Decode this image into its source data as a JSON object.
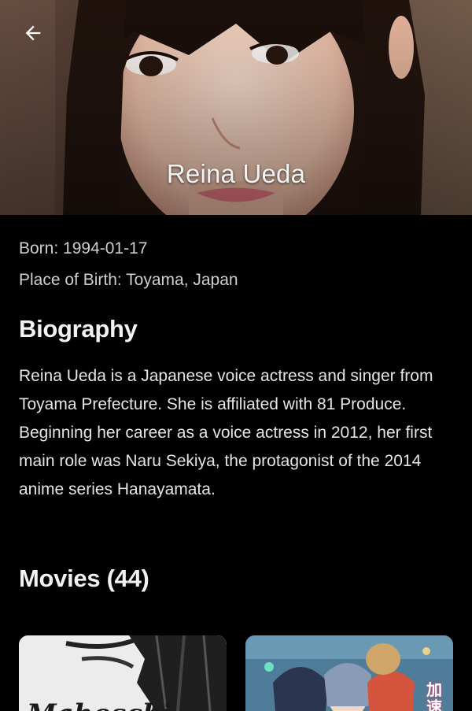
{
  "person": {
    "name": "Reina Ueda",
    "born": "Born: 1994-01-17",
    "place_of_birth": "Place of Birth: Toyama, Japan"
  },
  "biography": {
    "title": "Biography",
    "text": "Reina Ueda is a Japanese voice actress and singer from Toyama Prefecture. She is affiliated with 81 Produce. Beginning her career as a voice actress in 2012, her first main role was Naru Sekiya, the protagonist of the 2014 anime series Hanayamata."
  },
  "movies": {
    "title": "Movies (44)",
    "posters": [
      {
        "visible_text": "Mahoschi"
      },
      {
        "visible_text": "加速"
      }
    ]
  },
  "icons": {
    "back": "arrow-left-icon"
  },
  "colors": {
    "background": "#000000",
    "text_primary": "#f2f2f2",
    "text_secondary": "#cfcfcf"
  }
}
